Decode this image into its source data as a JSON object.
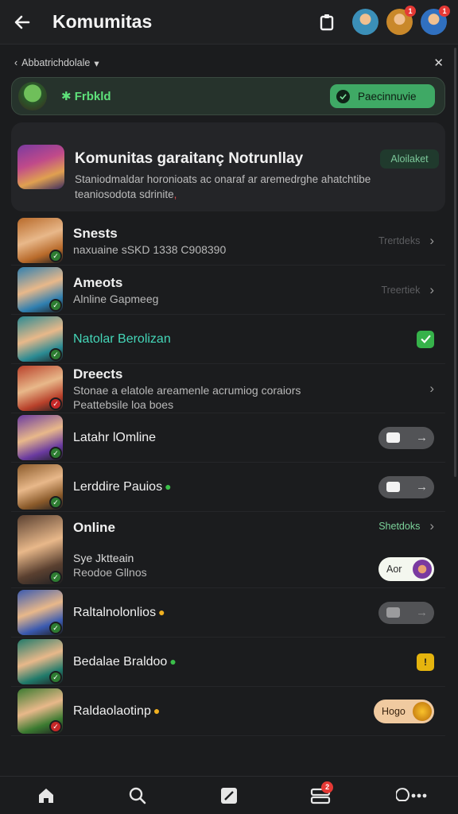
{
  "header": {
    "title": "Komumitas",
    "avatar_colors": [
      "#3b8fb8",
      "#c9882a",
      "#3070c0"
    ],
    "avatar_badges": [
      "",
      "1",
      "1"
    ]
  },
  "filter": {
    "chip_label": "Abbatrichdolale",
    "close_icon": "close-icon"
  },
  "active_card": {
    "label": "Frbkld",
    "pill_label": "Paecinnuvie"
  },
  "info_card": {
    "title": "Komunitas garaitanç Notrunllay",
    "badge": "Aloilaket",
    "desc_line1": "Staniodmaldar horonioats ac onaraf ar aremedrghe ahatchtibe",
    "desc_line2": "teaniosodota sdrinite",
    "desc_line2_suffix": ","
  },
  "rows": [
    {
      "name": "Snests",
      "sub": "naxuaine sSKD 1338 C908390",
      "right_label": "Trertdeks",
      "kind": "chevron-muted",
      "avatar": "#b86a2a"
    },
    {
      "name": "Ameots",
      "sub": "Alnline Gapmeeg",
      "right_label": "Treertiek",
      "kind": "chevron-muted",
      "avatar": "#2f7fb0"
    },
    {
      "name": "Natolar Berolizan",
      "sub": "",
      "right_label": "",
      "kind": "check",
      "avatar": "#2a8a93"
    },
    {
      "name": "Dreects",
      "sub": "Stonae a elatole areamenle acrumiog coraiors",
      "sub2": "Peattebsile loa boes",
      "right_label": "",
      "kind": "chevron",
      "avatar": "#b8402a"
    },
    {
      "name": "Latahr lOmline",
      "sub": "",
      "right_label": "",
      "kind": "toggle",
      "avatar": "#6a3aa0"
    },
    {
      "name": "Lerddire Pauios",
      "sub": "",
      "right_label": "",
      "kind": "toggle",
      "avatar": "#8a5a2a"
    },
    {
      "name": "Online",
      "sub": "Sye Jktteain",
      "sub2": "Reodoe Gllnos",
      "right_label": "Shetdoks",
      "chip_label": "Aor",
      "kind": "online",
      "avatar": "#5a4030"
    },
    {
      "name": "Raltalnolonlios",
      "sub": "",
      "right_label": "",
      "kind": "toggle-dim",
      "avatar": "#3a5ab0"
    },
    {
      "name": "Bedalae Braldoo",
      "sub": "",
      "right_label": "",
      "kind": "warn",
      "avatar": "#207a6a"
    },
    {
      "name": "Raldaolaotinp",
      "sub": "",
      "right_label": "",
      "chip_label": "Hogo",
      "kind": "orange",
      "avatar": "#3a7a30"
    }
  ],
  "bottom_nav": {
    "icons": [
      "home-icon",
      "search-icon",
      "edit-icon",
      "inbox-icon",
      "more-icon"
    ],
    "inbox_badge": "2"
  },
  "colors": {
    "background": "#1b1c1e",
    "accent_green": "#3fa965",
    "teal": "#44d6b8"
  }
}
